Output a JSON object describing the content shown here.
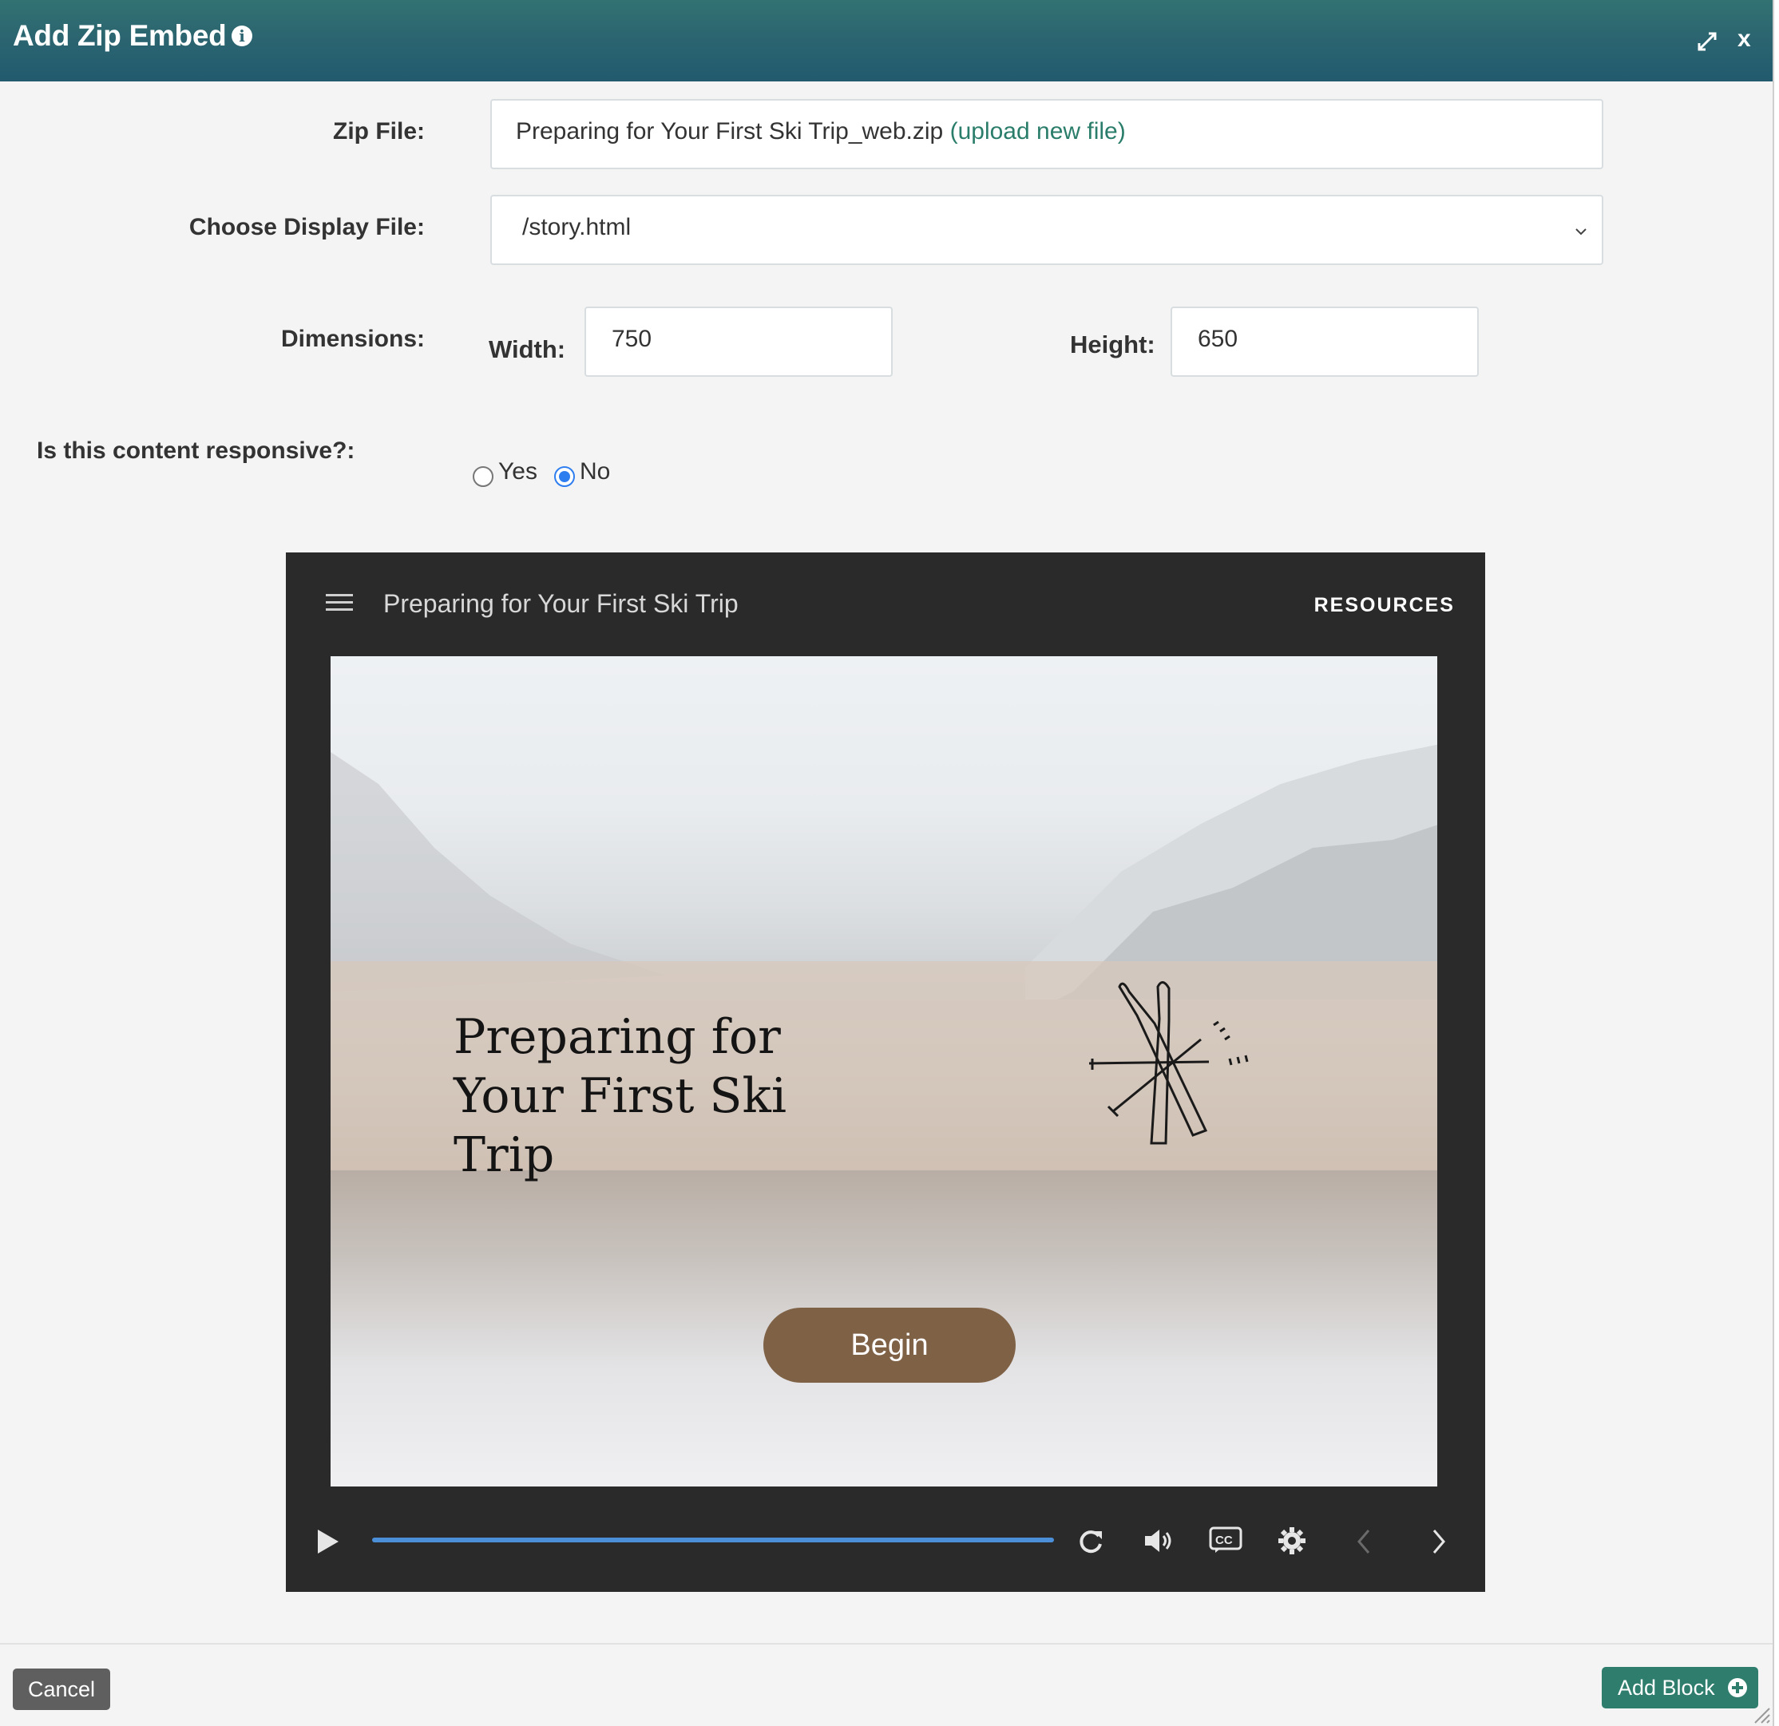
{
  "header": {
    "title": "Add Zip Embed",
    "info_icon": "i",
    "close_label": "x"
  },
  "form": {
    "zip_file": {
      "label": "Zip File:",
      "file_name": "Preparing for Your First Ski Trip_web.zip",
      "upload_link": "(upload new file)"
    },
    "display_file": {
      "label": "Choose Display File:",
      "selected": "/story.html"
    },
    "dimensions": {
      "label": "Dimensions:",
      "width_label": "Width:",
      "width_value": "750",
      "height_label": "Height:",
      "height_value": "650"
    },
    "responsive": {
      "label": "Is this content responsive?:",
      "options": [
        "Yes",
        "No"
      ],
      "selected": "No"
    }
  },
  "player": {
    "title": "Preparing for Your First Ski Trip",
    "resources_label": "RESOURCES",
    "slide_title": "Preparing for Your First Ski Trip",
    "begin_label": "Begin",
    "progress_fraction": 1.0,
    "accent_color": "#4c8fd9"
  },
  "footer": {
    "cancel_label": "Cancel",
    "add_label": "Add Block"
  },
  "colors": {
    "header": "#2b6470",
    "primary_button": "#2e7d6d",
    "begin_button": "#7f6146"
  }
}
